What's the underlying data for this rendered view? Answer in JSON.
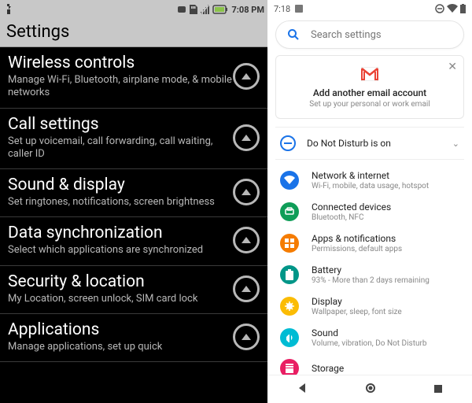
{
  "left": {
    "status_time": "7:08 PM",
    "title": "Settings",
    "items": [
      {
        "title": "Wireless controls",
        "sub": "Manage Wi-Fi, Bluetooth, airplane mode, & mobile networks"
      },
      {
        "title": "Call settings",
        "sub": "Set up voicemail, call forwarding, call waiting, caller ID"
      },
      {
        "title": "Sound & display",
        "sub": "Set ringtones, notifications, screen brightness"
      },
      {
        "title": "Data synchronization",
        "sub": "Select which applications are synchronized"
      },
      {
        "title": "Security & location",
        "sub": "My Location, screen unlock, SIM card lock"
      },
      {
        "title": "Applications",
        "sub": "Manage applications, set up quick"
      }
    ]
  },
  "right": {
    "status_time": "7:18",
    "search_placeholder": "Search settings",
    "card": {
      "title": "Add another email account",
      "sub": "Set up your personal or work email"
    },
    "dnd_label": "Do Not Disturb is on",
    "items": [
      {
        "title": "Network & internet",
        "sub": "Wi-Fi, mobile, data usage, hotspot",
        "color": "#1a73e8"
      },
      {
        "title": "Connected devices",
        "sub": "Bluetooth, NFC",
        "color": "#0f9d58"
      },
      {
        "title": "Apps & notifications",
        "sub": "Permissions, default apps",
        "color": "#f57c00"
      },
      {
        "title": "Battery",
        "sub": "93% - More than 2 days remaining",
        "color": "#009688"
      },
      {
        "title": "Display",
        "sub": "Wallpaper, sleep, font size",
        "color": "#fbbc04"
      },
      {
        "title": "Sound",
        "sub": "Volume, vibration, Do Not Disturb",
        "color": "#00bcd4"
      },
      {
        "title": "Storage",
        "sub": "",
        "color": "#e91e63"
      }
    ]
  }
}
